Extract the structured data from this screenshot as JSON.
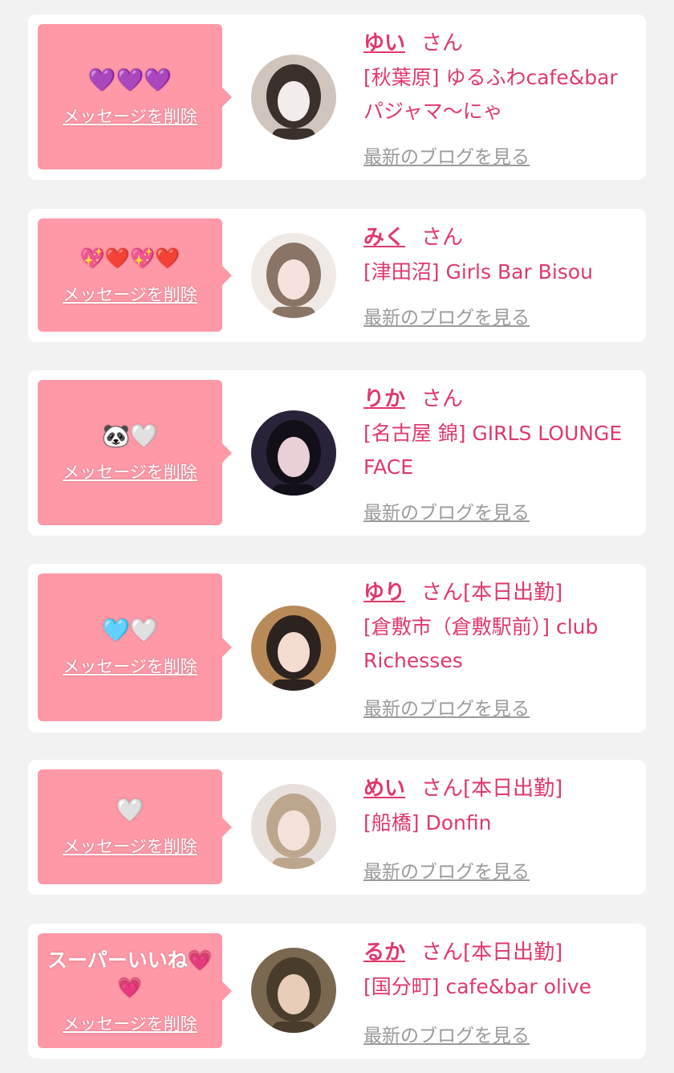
{
  "cards": [
    {
      "message": "💜💜💜",
      "delete_label": "メッセージを削除",
      "name": "ゆい",
      "suffix": "さん",
      "status": "",
      "shop": "[秋葉原] ゆるふわcafe&bar パジャマ〜にゃ",
      "blog_label": "最新のブログを見る",
      "avatar_colors": [
        "#cfc5bd",
        "#3a302c",
        "#f2ecec"
      ]
    },
    {
      "message": "💖❤️💖❤️",
      "delete_label": "メッセージを削除",
      "name": "みく",
      "suffix": "さん",
      "status": "",
      "shop": "[津田沼] Girls Bar Bisou",
      "blog_label": "最新のブログを見る",
      "avatar_colors": [
        "#efeae6",
        "#8a7466",
        "#f6e1dc"
      ]
    },
    {
      "message": "🐼🤍",
      "delete_label": "メッセージを削除",
      "name": "りか",
      "suffix": "さん",
      "status": "",
      "shop": "[名古屋 錦] GIRLS LOUNGE FACE",
      "blog_label": "最新のブログを見る",
      "avatar_colors": [
        "#2a2238",
        "#120f18",
        "#e8d0d6"
      ]
    },
    {
      "message": "🩵🤍",
      "delete_label": "メッセージを削除",
      "name": "ゆり",
      "suffix": "さん",
      "status": "[本日出勤]",
      "shop": "[倉敷市（倉敷駅前）] club Richesses",
      "blog_label": "最新のブログを見る",
      "avatar_colors": [
        "#b88a58",
        "#2c2220",
        "#f4dcd0"
      ]
    },
    {
      "message": "🤍",
      "delete_label": "メッセージを削除",
      "name": "めい",
      "suffix": "さん",
      "status": "[本日出勤]",
      "shop": "[船橋] Donfin",
      "blog_label": "最新のブログを見る",
      "avatar_colors": [
        "#e8e0dc",
        "#bda68e",
        "#f3e2da"
      ]
    },
    {
      "message": "スーパーいいね💗💗",
      "delete_label": "メッセージを削除",
      "name": "るか",
      "suffix": "さん",
      "status": "[本日出勤]",
      "shop": "[国分町] cafe&bar olive",
      "blog_label": "最新のブログを見る",
      "avatar_colors": [
        "#7a6850",
        "#4a3c2c",
        "#e8cdb8"
      ]
    }
  ]
}
